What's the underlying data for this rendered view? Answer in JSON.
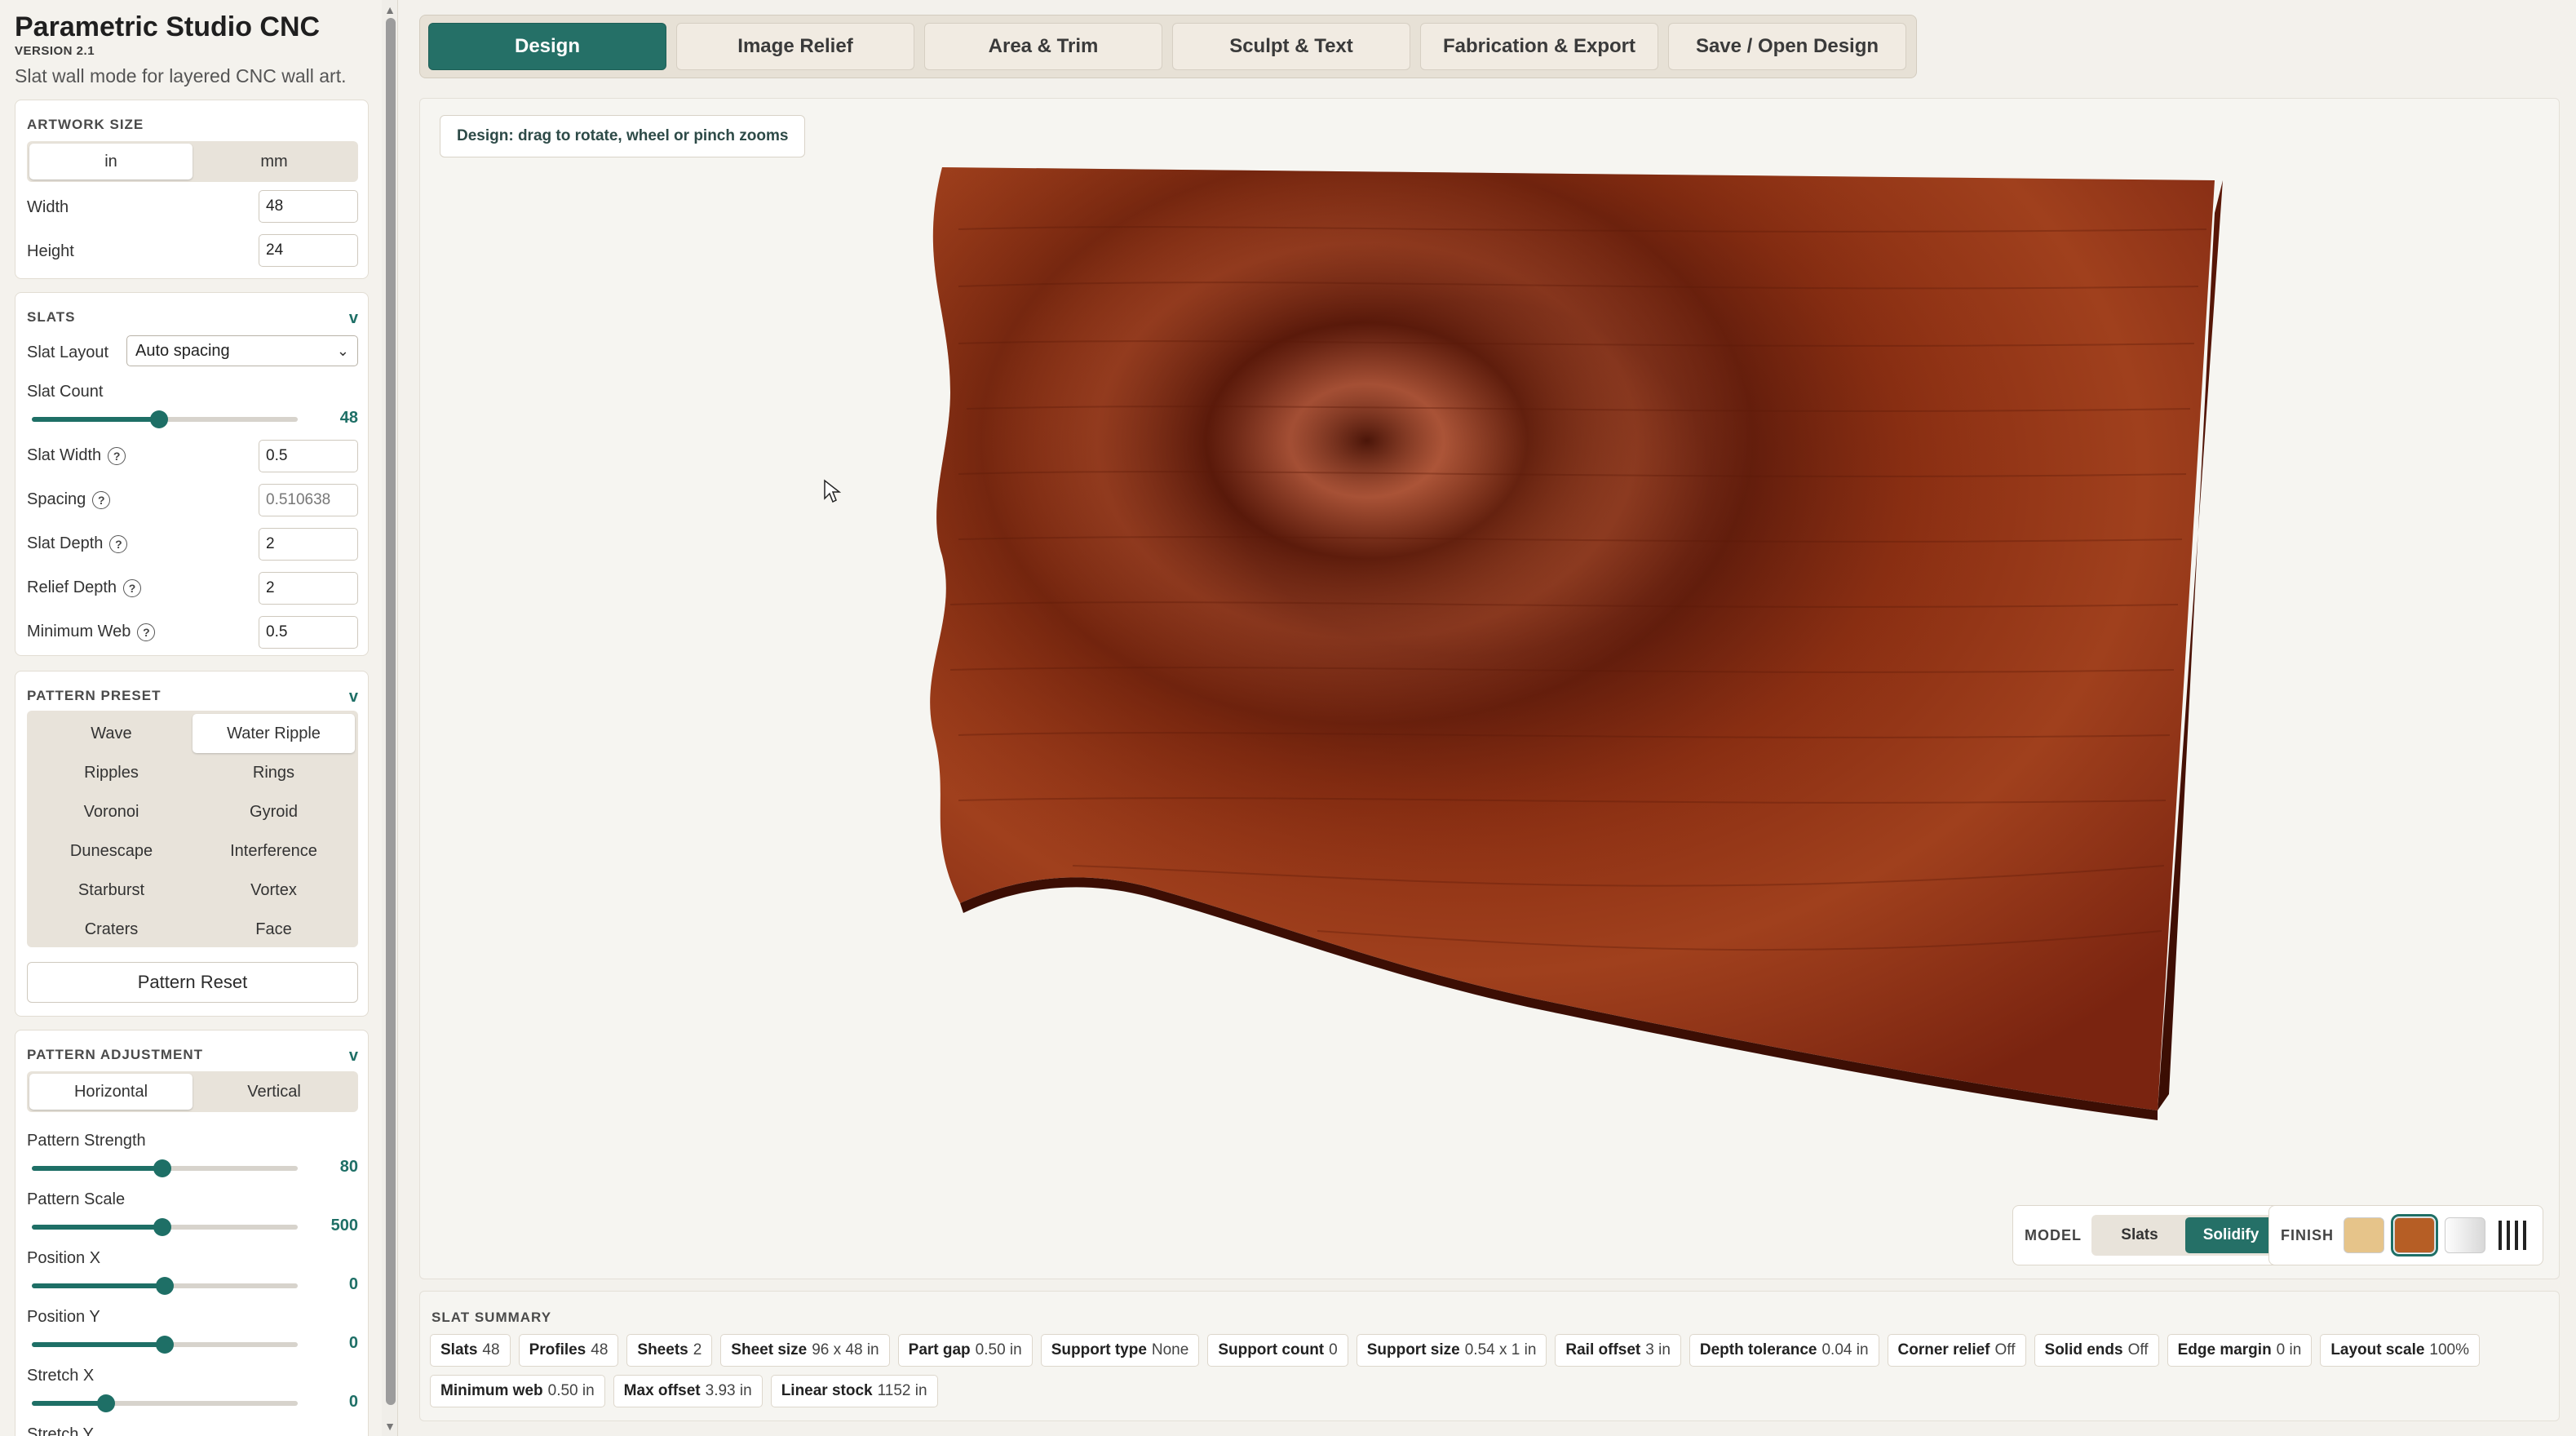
{
  "app": {
    "title": "Parametric Studio CNC",
    "version": "VERSION 2.1",
    "subtitle": "Slat wall mode for layered CNC wall art."
  },
  "artwork_size": {
    "title": "ARTWORK SIZE",
    "units": [
      "in",
      "mm"
    ],
    "active_unit": "in",
    "width_label": "Width",
    "width_value": "48",
    "height_label": "Height",
    "height_value": "24"
  },
  "slats": {
    "title": "SLATS",
    "collapse": "v",
    "layout_label": "Slat Layout",
    "layout_value": "Auto spacing",
    "count_label": "Slat Count",
    "count_value": "48",
    "count_level": 0.48,
    "width_label": "Slat Width",
    "width_value": "0.5",
    "spacing_label": "Spacing",
    "spacing_value": "0.510638",
    "depth_label": "Slat Depth",
    "depth_value": "2",
    "relief_label": "Relief Depth",
    "relief_value": "2",
    "web_label": "Minimum Web",
    "web_value": "0.5"
  },
  "pattern_preset": {
    "title": "PATTERN PRESET",
    "collapse": "v",
    "options": [
      "Wave",
      "Water Ripple",
      "Ripples",
      "Rings",
      "Voronoi",
      "Gyroid",
      "Dunescape",
      "Interference",
      "Starburst",
      "Vortex",
      "Craters",
      "Face"
    ],
    "active": "Water Ripple",
    "reset_label": "Pattern Reset"
  },
  "pattern_adjustment": {
    "title": "PATTERN ADJUSTMENT",
    "collapse": "v",
    "orientations": [
      "Horizontal",
      "Vertical"
    ],
    "active_orientation": "Horizontal",
    "strength_label": "Pattern Strength",
    "strength_value": "80",
    "strength_level": 0.49,
    "scale_label": "Pattern Scale",
    "scale_value": "500",
    "scale_level": 0.49,
    "posx_label": "Position X",
    "posx_value": "0",
    "posx_level": 0.5,
    "posy_label": "Position Y",
    "posy_value": "0",
    "posy_level": 0.5,
    "stretchx_label": "Stretch X",
    "stretchx_value": "0",
    "stretchx_level": 0.28,
    "stretchy_label": "Stretch Y"
  },
  "tabs": [
    "Design",
    "Image Relief",
    "Area & Trim",
    "Sculpt & Text",
    "Fabrication & Export",
    "Save / Open Design"
  ],
  "active_tab": "Design",
  "viewport": {
    "hint": "Design: drag to rotate, wheel or pinch zooms",
    "model_label": "MODEL",
    "model_options": [
      "Slats",
      "Solidify"
    ],
    "model_active": "Solidify",
    "finish_label": "FINISH",
    "finish_swatches": [
      {
        "name": "maple-swatch",
        "color": "#e6c48a"
      },
      {
        "name": "walnut-swatch",
        "color": "#b65e25"
      },
      {
        "name": "white-swatch",
        "color": "#e9e9e9"
      },
      {
        "name": "slats-swatch",
        "color": "#222222"
      }
    ],
    "wood_color": "#7a2410"
  },
  "summary": {
    "title": "SLAT SUMMARY",
    "items": [
      {
        "label": "Slats",
        "value": "48"
      },
      {
        "label": "Profiles",
        "value": "48"
      },
      {
        "label": "Sheets",
        "value": "2"
      },
      {
        "label": "Sheet size",
        "value": "96 x 48 in"
      },
      {
        "label": "Part gap",
        "value": "0.50 in"
      },
      {
        "label": "Support type",
        "value": "None"
      },
      {
        "label": "Support count",
        "value": "0"
      },
      {
        "label": "Support size",
        "value": "0.54 x 1 in"
      },
      {
        "label": "Rail offset",
        "value": "3 in"
      },
      {
        "label": "Depth tolerance",
        "value": "0.04 in"
      },
      {
        "label": "Corner relief",
        "value": "Off"
      },
      {
        "label": "Solid ends",
        "value": "Off"
      },
      {
        "label": "Edge margin",
        "value": "0 in"
      },
      {
        "label": "Layout scale",
        "value": "100%"
      },
      {
        "label": "Minimum web",
        "value": "0.50 in"
      },
      {
        "label": "Max offset",
        "value": "3.93 in"
      },
      {
        "label": "Linear stock",
        "value": "1152 in"
      }
    ]
  }
}
